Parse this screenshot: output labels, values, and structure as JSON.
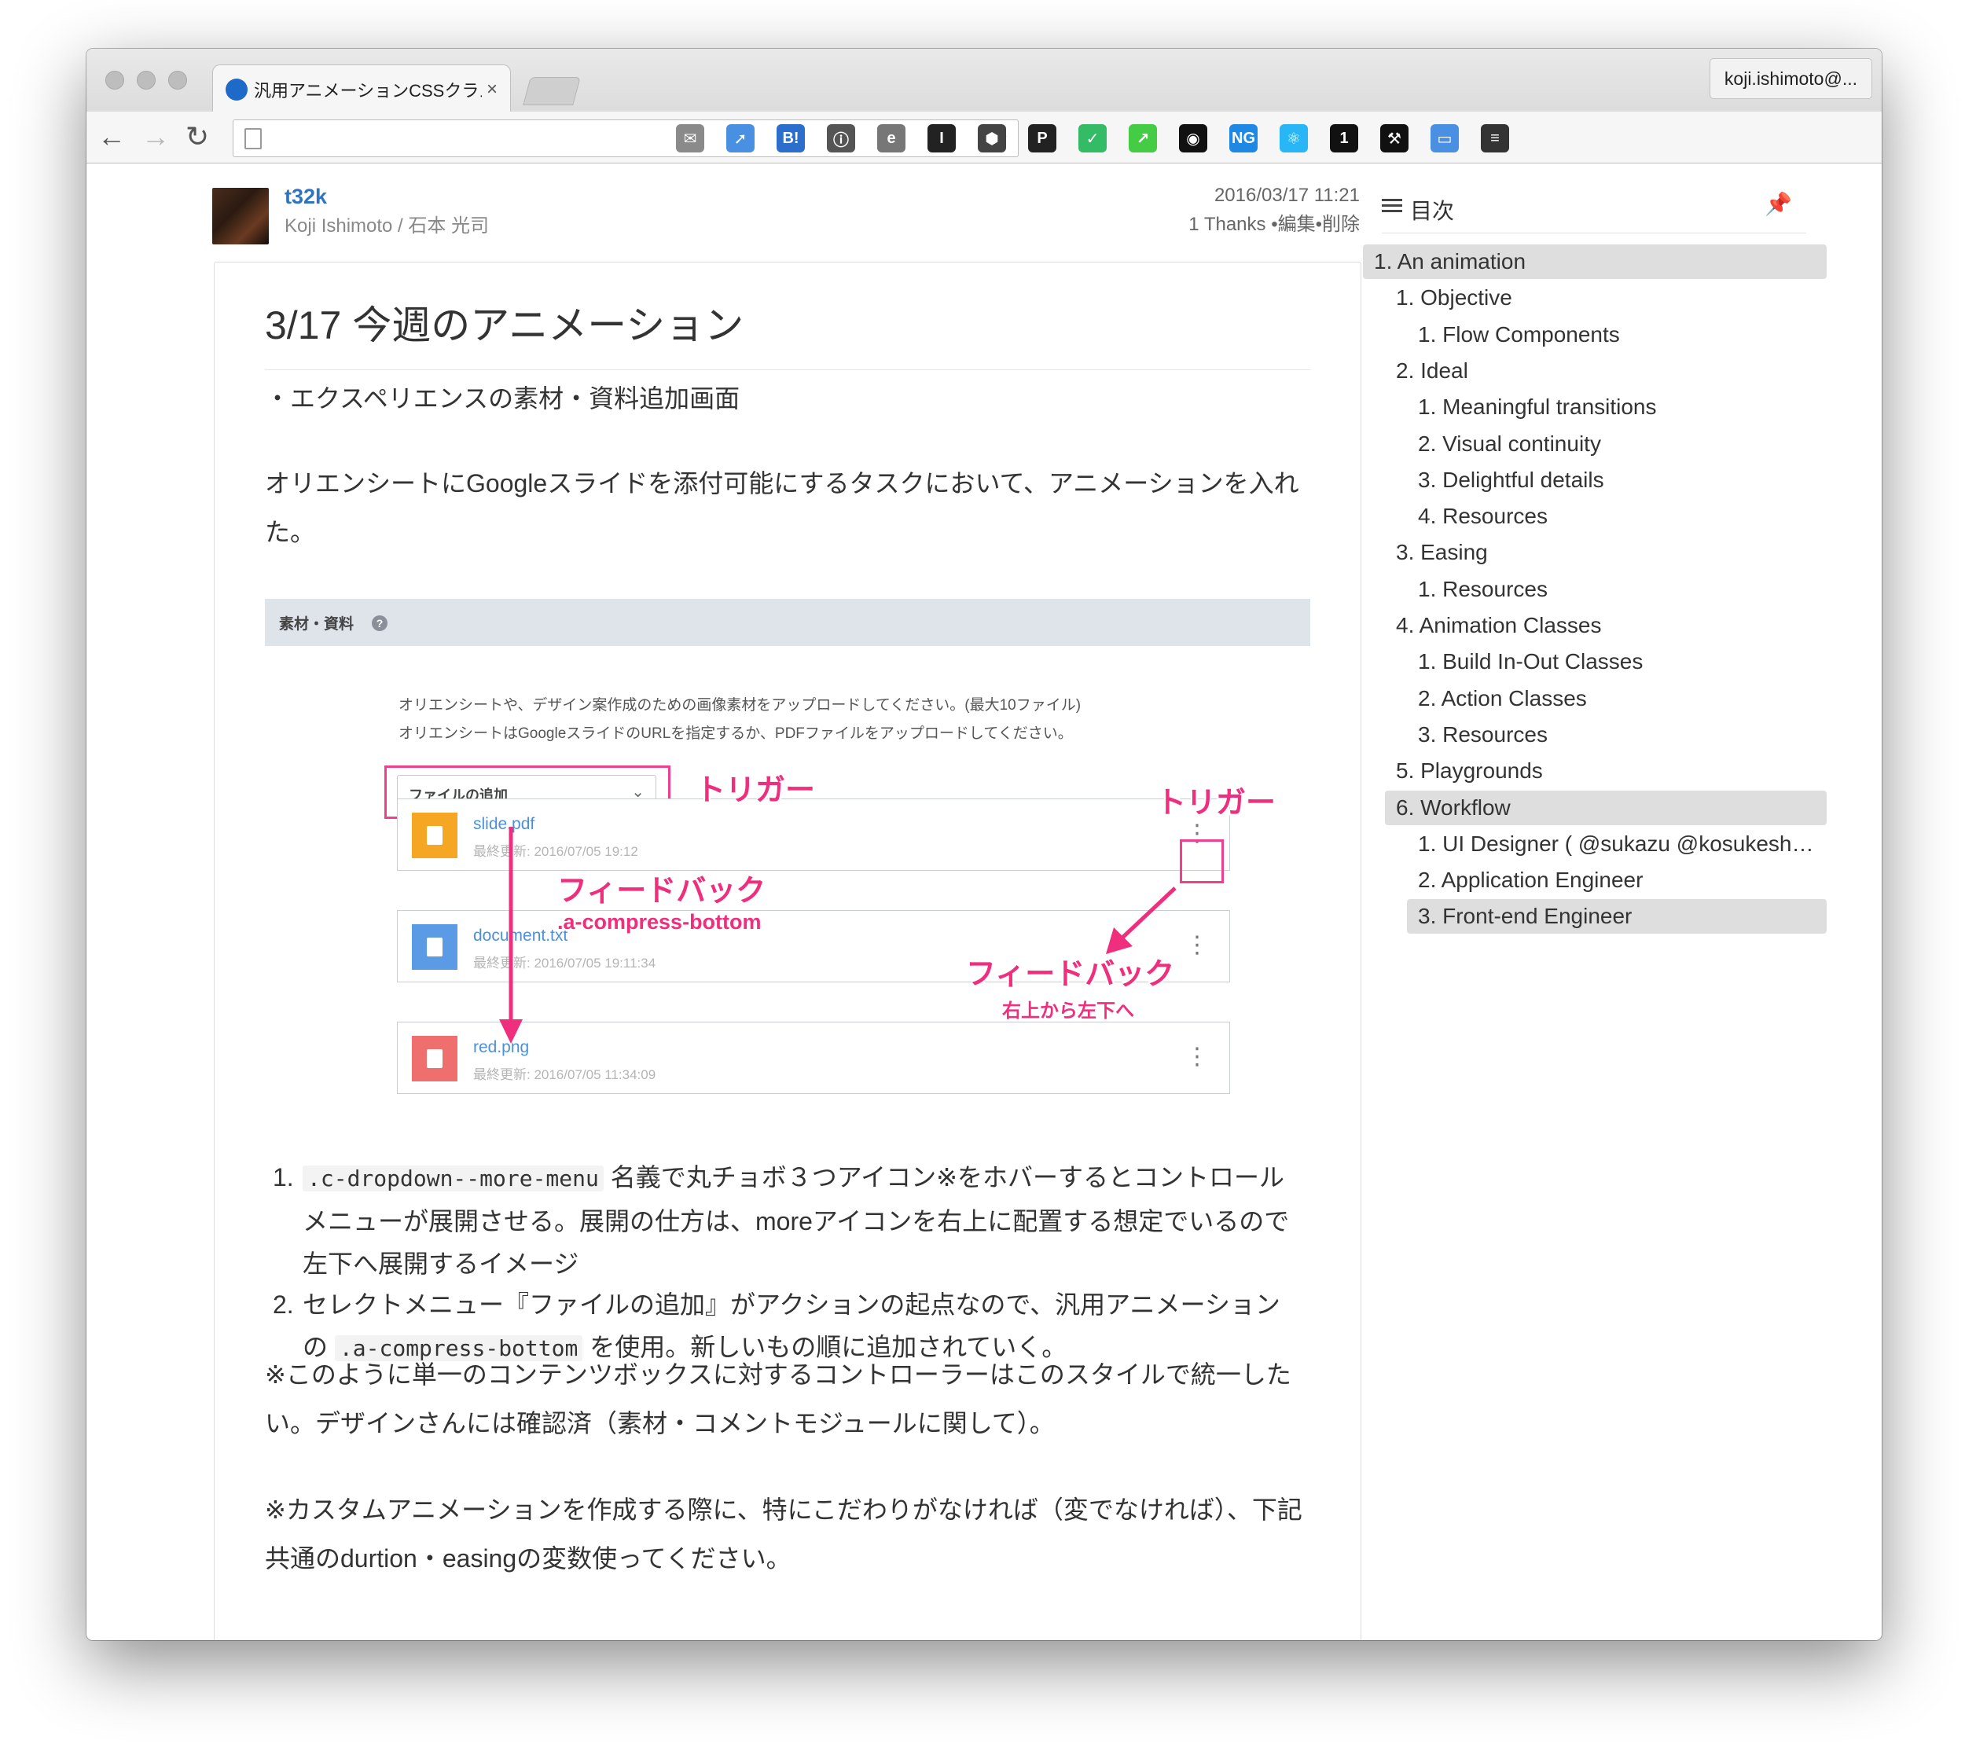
{
  "browser": {
    "tab_title": "汎用アニメーションCSSクラス",
    "tab_close": "×",
    "profile_label": "koji.ishimoto@...",
    "extensions": [
      "gmail-checker-icon",
      "pushbullet-icon",
      "hatena-bookmark-icon",
      "1password-icon",
      "evernote-icon",
      "instapaper-icon",
      "sketch-icon",
      "pocket-icon",
      "todoist-icon",
      "charts-icon",
      "color-picker-icon",
      "ng-inspector-icon",
      "react-devtools-icon",
      "one-icon",
      "hammer-icon",
      "window-resizer-icon",
      "menu-icon"
    ]
  },
  "author": {
    "username": "t32k",
    "full_name": "Koji Ishimoto / 石本 光司"
  },
  "meta": {
    "date": "2016/03/17 11:21",
    "actions": "1 Thanks •編集•削除"
  },
  "article": {
    "title": "3/17 今週のアニメーション",
    "intro": "・エクスペリエンスの素材・資料追加画面",
    "para1": "オリエンシートにGoogleスライドを添付可能にするタスクにおいて、アニメーションを入れた。",
    "figure": {
      "header_label": "素材・資料",
      "help": "?",
      "desc_line1": "オリエンシートや、デザイン案作成のための画像素材をアップロードしてください。(最大10ファイル)",
      "desc_line2": "オリエンシートはGoogleスライドのURLを指定するか、PDFファイルをアップロードしてください。",
      "select_label": "ファイルの追加",
      "files": [
        {
          "name": "slide.pdf",
          "date": "最終更新: 2016/07/05 19:12",
          "color": "#f5a623"
        },
        {
          "name": "document.txt",
          "date": "最終更新: 2016/07/05 19:11:34",
          "color": "#5b9be6"
        },
        {
          "name": "red.png",
          "date": "最終更新: 2016/07/05 11:34:09",
          "color": "#ef6e6e"
        }
      ],
      "annotations": {
        "trigger_left": "トリガー",
        "trigger_right": "トリガー",
        "feedback_left": "フィードバック",
        "feedback_left_class": ".a-compress-bottom",
        "feedback_right": "フィードバック",
        "feedback_right_note": "右上から左下へ"
      },
      "accent_color": "#ef3f8d"
    },
    "list": [
      {
        "num": "1.",
        "code": ".c-dropdown--more-menu",
        "text": " 名義で丸チョボ３つアイコン※をホバーするとコントロールメニューが展開させる。展開の仕方は、moreアイコンを右上に配置する想定でいるので左下へ展開するイメージ"
      },
      {
        "num": "2.",
        "pre": "セレクトメニュー『ファイルの追加』がアクションの起点なので、汎用アニメーションの ",
        "code": ".a-compress-bottom",
        "post": " を使用。新しいもの順に追加されていく。"
      }
    ],
    "note1": "※このように単一のコンテンツボックスに対するコントローラーはこのスタイルで統一したい。デザインさんには確認済（素材・コメントモジュールに関して）。",
    "note2": "※カスタムアニメーションを作成する際に、特にこだわりがなければ（変でなければ）、下記共通のdurtion・easingの変数使ってください。"
  },
  "toc": {
    "title": "目次",
    "items": [
      {
        "label": "1. An animation",
        "level": 0,
        "active": true
      },
      {
        "label": "1. Objective",
        "level": 1,
        "active": false
      },
      {
        "label": "1. Flow Components",
        "level": 2,
        "active": false
      },
      {
        "label": "2. Ideal",
        "level": 1,
        "active": false
      },
      {
        "label": "1. Meaningful transitions",
        "level": 2,
        "active": false
      },
      {
        "label": "2. Visual continuity",
        "level": 2,
        "active": false
      },
      {
        "label": "3. Delightful details",
        "level": 2,
        "active": false
      },
      {
        "label": "4. Resources",
        "level": 2,
        "active": false
      },
      {
        "label": "3. Easing",
        "level": 1,
        "active": false
      },
      {
        "label": "1. Resources",
        "level": 2,
        "active": false
      },
      {
        "label": "4. Animation Classes",
        "level": 1,
        "active": false
      },
      {
        "label": "1. Build In-Out Classes",
        "level": 2,
        "active": false
      },
      {
        "label": "2. Action Classes",
        "level": 2,
        "active": false
      },
      {
        "label": "3. Resources",
        "level": 2,
        "active": false
      },
      {
        "label": "5. Playgrounds",
        "level": 1,
        "active": false
      },
      {
        "label": "6. Workflow",
        "level": 1,
        "active": true
      },
      {
        "label": "1. UI Designer ( @sukazu @kosukesh…",
        "level": 2,
        "active": false
      },
      {
        "label": "2. Application Engineer",
        "level": 2,
        "active": false
      },
      {
        "label": "3. Front-end Engineer",
        "level": 2,
        "active": true
      }
    ]
  }
}
